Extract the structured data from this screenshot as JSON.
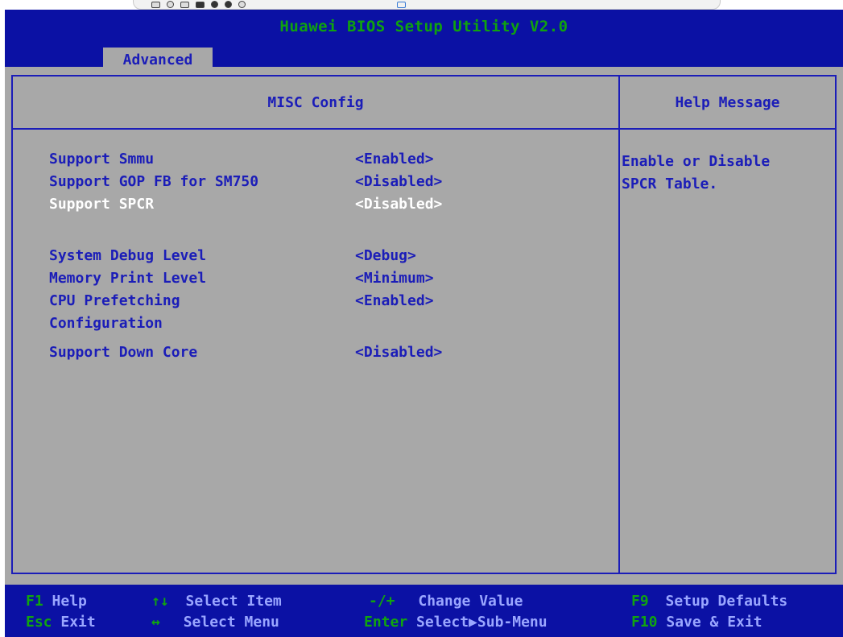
{
  "header": {
    "title": "Huawei BIOS Setup Utility V2.0",
    "active_tab": "Advanced"
  },
  "panel": {
    "title": "MISC Config",
    "help_title": "Help Message",
    "help_text": "Enable or Disable\nSPCR Table."
  },
  "settings": [
    {
      "label": "Support Smmu",
      "value": "<Enabled>"
    },
    {
      "label": "Support GOP FB for SM750",
      "value": "<Disabled>"
    },
    {
      "label": "Support SPCR",
      "value": "<Disabled>",
      "selected": true
    },
    {
      "label": "System Debug Level",
      "value": "<Debug>"
    },
    {
      "label": "Memory Print Level",
      "value": "<Minimum>"
    },
    {
      "label": "CPU Prefetching",
      "value": "<Enabled>"
    },
    {
      "label": "Configuration",
      "value": ""
    },
    {
      "label": "Support Down Core",
      "value": "<Disabled>"
    }
  ],
  "footer": [
    {
      "key": "F1",
      "desc": "Help"
    },
    {
      "key": "↑↓",
      "desc": "Select Item"
    },
    {
      "key": "-/+",
      "desc": "Change Value"
    },
    {
      "key": "F9",
      "desc": "Setup Defaults"
    },
    {
      "key": "Esc",
      "desc": "Exit"
    },
    {
      "key": "↔",
      "desc": "Select Menu"
    },
    {
      "key": "Enter",
      "desc": "Select▶Sub-Menu"
    },
    {
      "key": "F10",
      "desc": "Save & Exit"
    }
  ],
  "colors": {
    "header_bg": "#0b11a4",
    "body_bg": "#a8a8a8",
    "text_blue": "#1b1db8",
    "key_green": "#10a410",
    "selected_text": "#ffffff"
  }
}
